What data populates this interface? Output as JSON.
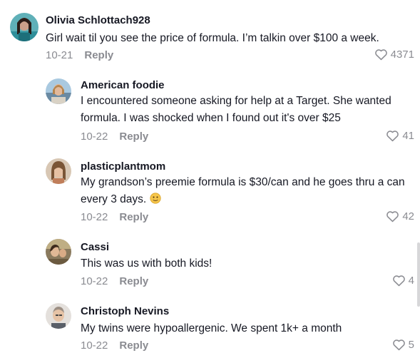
{
  "comments": [
    {
      "username": "Olivia Schlottach928",
      "text": "Girl wait til you see the price of formula. I’m talkin over $100 a week.",
      "date": "10-21",
      "reply_label": "Reply",
      "likes": "4371",
      "avatar": "avatar-photo"
    },
    {
      "username": "American foodie",
      "text": "I encountered someone asking for help at a Target. She wanted formula. I was shocked when I found out it's over $25",
      "date": "10-22",
      "reply_label": "Reply",
      "likes": "41",
      "avatar": "avatar-photo"
    },
    {
      "username": "plasticplantmom",
      "text": "My grandson’s preemie formula is $30/can and he goes thru a can every 3 days.",
      "emoji": "face-emoji",
      "date": "10-22",
      "reply_label": "Reply",
      "likes": "42",
      "avatar": "avatar-photo"
    },
    {
      "username": "Cassi",
      "text": "This was us with both kids!",
      "date": "10-22",
      "reply_label": "Reply",
      "likes": "4",
      "avatar": "avatar-photo"
    },
    {
      "username": "Christoph Nevins",
      "text": "My twins were hypoallergenic. We spent 1k+ a month",
      "date": "10-22",
      "reply_label": "Reply",
      "likes": "5",
      "avatar": "avatar-photo"
    }
  ],
  "colors": {
    "text": "#161823",
    "muted": "#8a8b91",
    "background": "#ffffff"
  }
}
